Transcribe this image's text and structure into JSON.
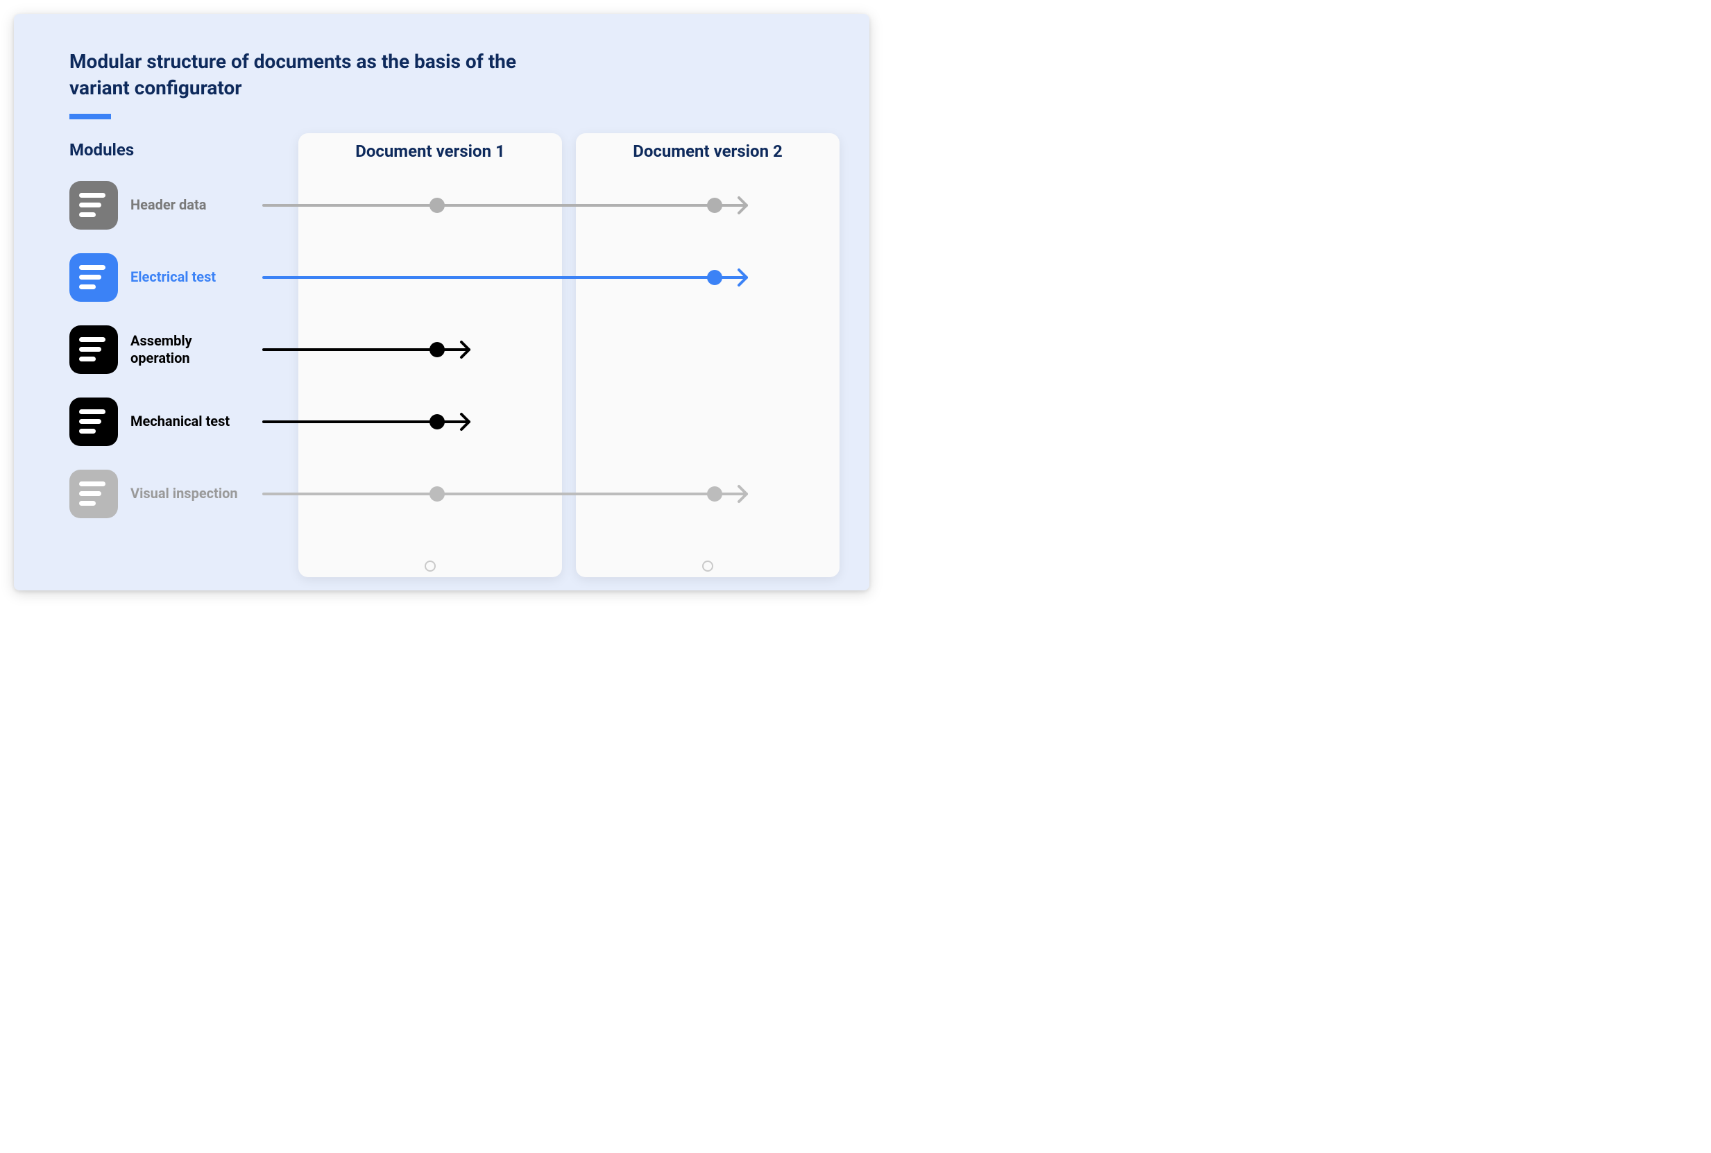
{
  "title": "Modular structure of documents as the basis of the variant configurator",
  "columns": {
    "modules": "Modules",
    "v1": "Document version 1",
    "v2": "Document version 2"
  },
  "modules": [
    {
      "label": "Header data",
      "color": "gray"
    },
    {
      "label": "Electrical test",
      "color": "blue"
    },
    {
      "label": "Assembly operation",
      "color": "black"
    },
    {
      "label": "Mechanical test",
      "color": "black"
    },
    {
      "label": "Visual inspection",
      "color": "light"
    }
  ],
  "arrows": [
    {
      "module": 0,
      "stops": [
        "v1"
      ],
      "end": "v2",
      "continues": true,
      "color": "#b0b0b0"
    },
    {
      "module": 1,
      "stops": [],
      "end": "v2",
      "continues": true,
      "color": "#3b82f6"
    },
    {
      "module": 2,
      "stops": [],
      "end": "v1",
      "continues": false,
      "color": "#000000"
    },
    {
      "module": 3,
      "stops": [],
      "end": "v1",
      "continues": false,
      "color": "#000000"
    },
    {
      "module": 4,
      "stops": [
        "v1"
      ],
      "end": "v2",
      "continues": true,
      "color": "#bcbcbc"
    }
  ],
  "geometry": {
    "rowStartY": 94,
    "rowSpacing": 104,
    "lineStartX": 280,
    "v1X": 530,
    "v2X": 930,
    "arrowExtra": 46,
    "dotR": 11,
    "strokeW": 4
  }
}
